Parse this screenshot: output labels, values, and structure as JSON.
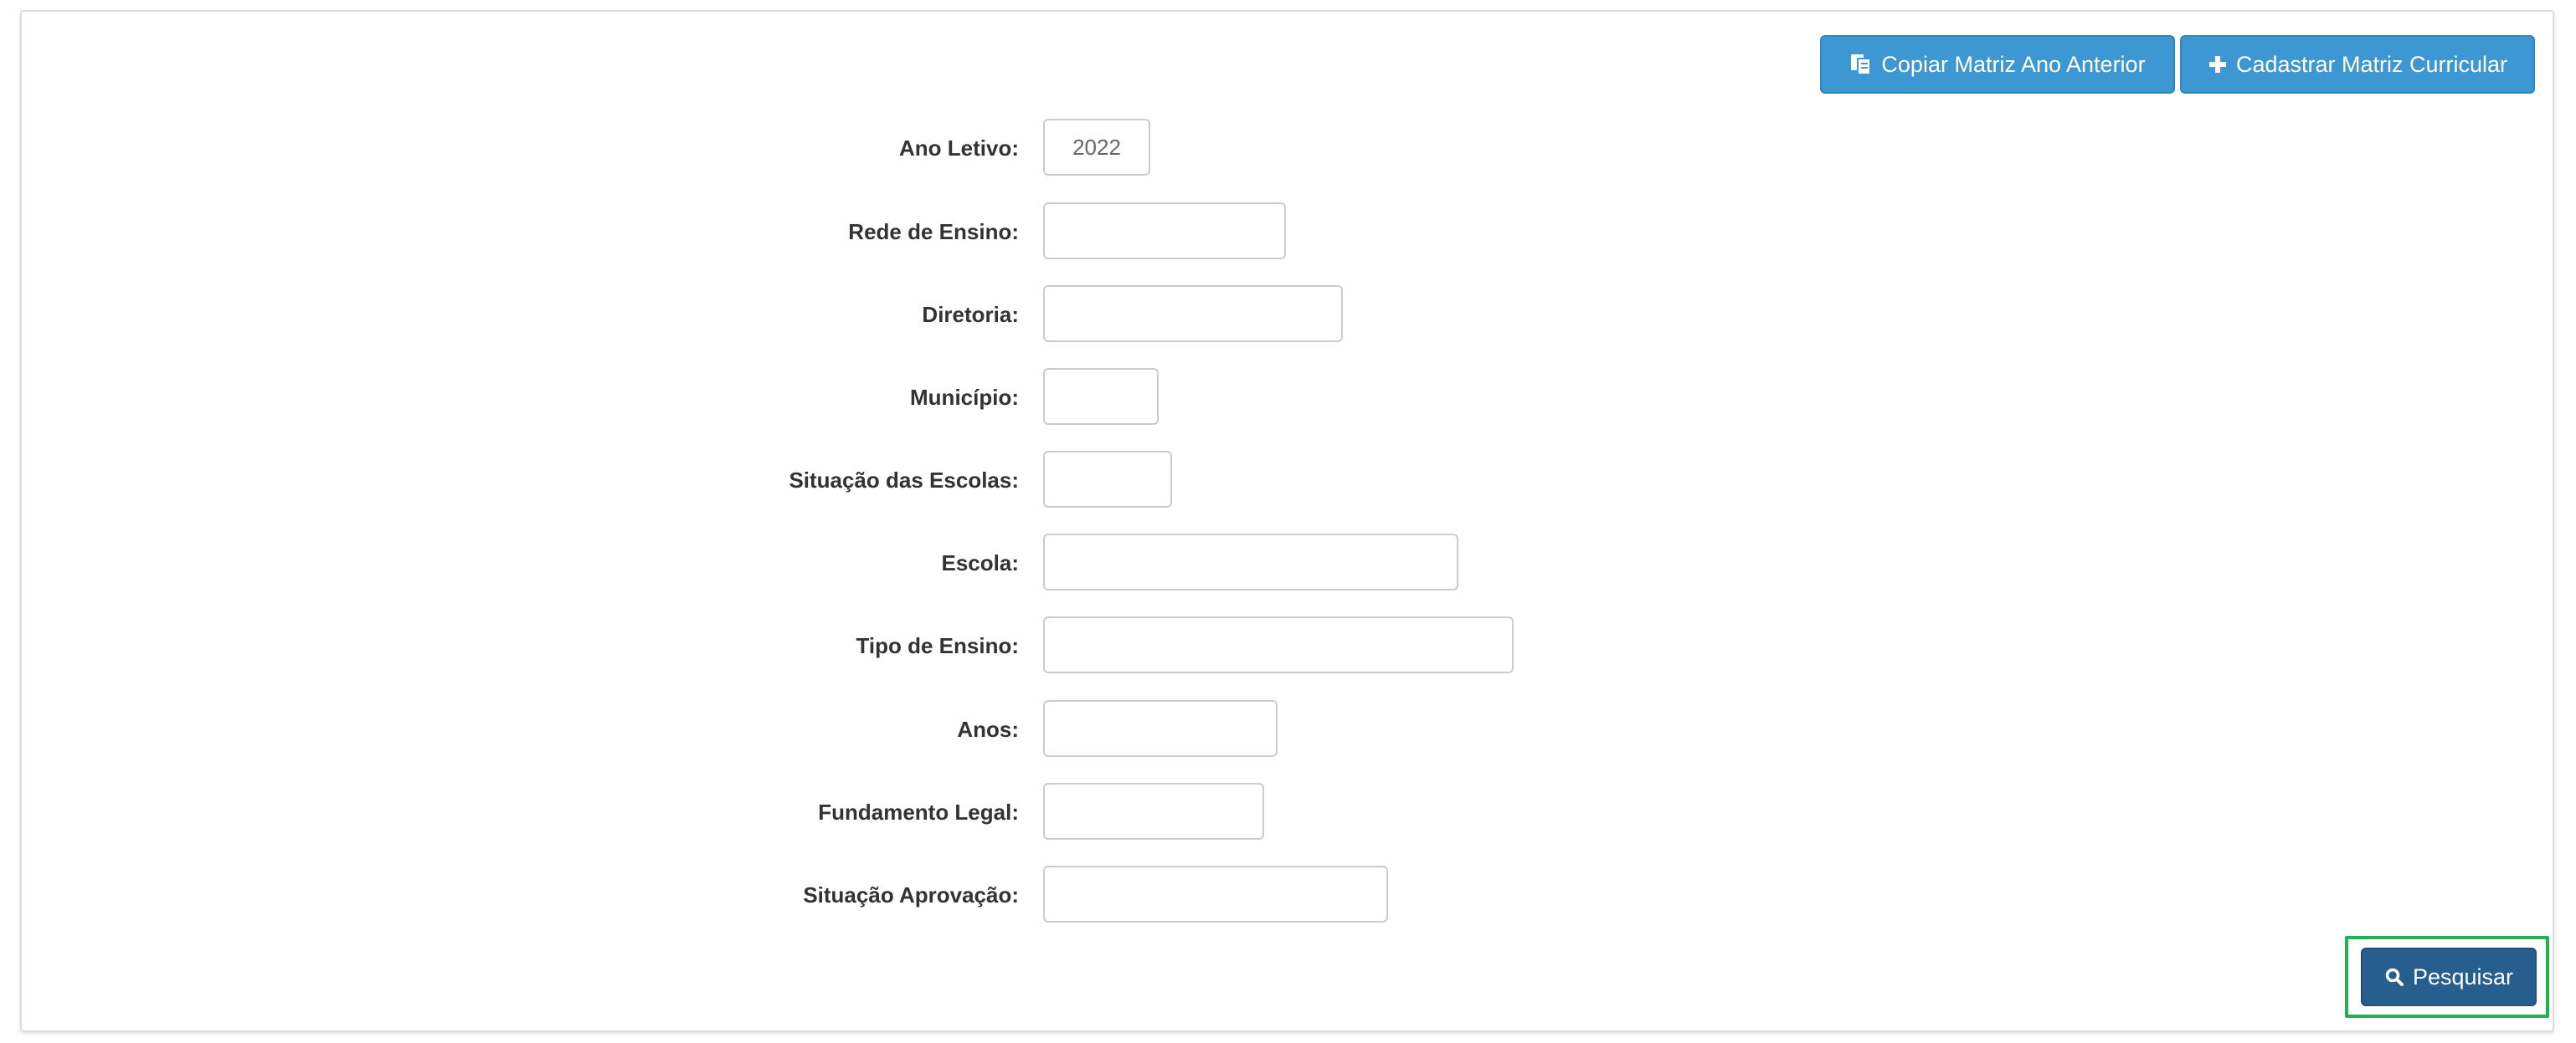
{
  "toolbar": {
    "copy_label": "Copiar Matriz Ano Anterior",
    "copy_icon": "copy-icon",
    "add_label": "Cadastrar Matriz Curricular",
    "add_icon": "plus-icon",
    "button_color": "#3c97d3"
  },
  "form": {
    "fields": [
      {
        "label": "Ano Letivo:",
        "value": "2022"
      },
      {
        "label": "Rede de Ensino:",
        "value": ""
      },
      {
        "label": "Diretoria:",
        "value": ""
      },
      {
        "label": "Município:",
        "value": ""
      },
      {
        "label": "Situação das Escolas:",
        "value": ""
      },
      {
        "label": "Escola:",
        "value": ""
      },
      {
        "label": "Tipo de Ensino:",
        "value": ""
      },
      {
        "label": "Anos:",
        "value": ""
      },
      {
        "label": "Fundamento Legal:",
        "value": ""
      },
      {
        "label": "Situação Aprovação:",
        "value": ""
      }
    ]
  },
  "search": {
    "label": "Pesquisar",
    "icon": "search-icon",
    "button_color": "#285e8e",
    "highlight_color": "#22b14c"
  }
}
